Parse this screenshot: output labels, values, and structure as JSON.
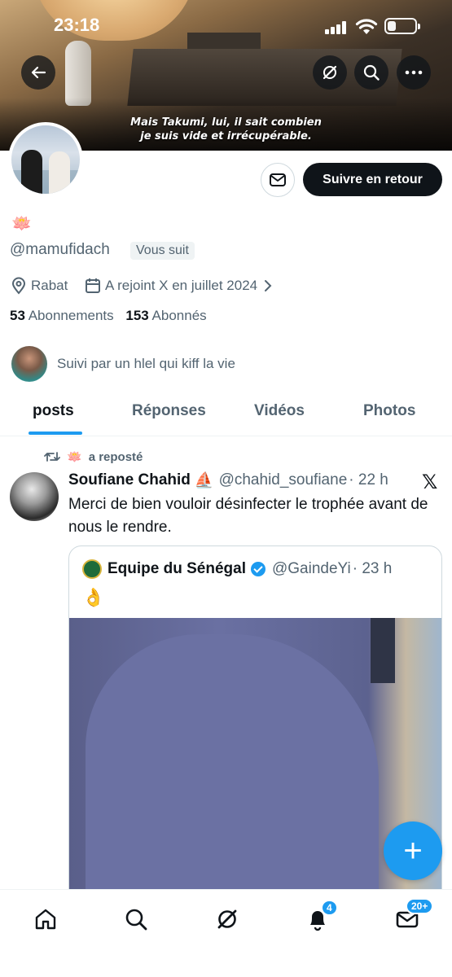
{
  "status_bar": {
    "time": "23:18"
  },
  "banner": {
    "subtitle_line1": "Mais Takumi, lui, il sait combien",
    "subtitle_line2": "je suis vide et irrécupérable."
  },
  "header_actions": {
    "back": "back-arrow-icon",
    "grok": "grok-icon",
    "search": "search-icon",
    "more": "more-icon"
  },
  "profile": {
    "display_name_emoji": "🪷",
    "handle": "@mamufidach",
    "follows_you": "Vous suit",
    "follow_back_label": "Suivre en retour",
    "location": "Rabat",
    "joined": "A rejoint X en juillet 2024",
    "following_count": "53",
    "following_label": "Abonnements",
    "followers_count": "153",
    "followers_label": "Abonnés",
    "followed_by": "Suivi par un hlel qui kiff la vie"
  },
  "tabs": [
    {
      "label": "posts",
      "active": true
    },
    {
      "label": "Réponses",
      "active": false
    },
    {
      "label": "Vidéos",
      "active": false
    },
    {
      "label": "Photos",
      "active": false
    }
  ],
  "tweet": {
    "repost_emoji": "🪷",
    "repost_text": "a reposté",
    "author_name": "Soufiane Chahid",
    "author_emoji": "⛵",
    "author_handle": "@chahid_soufiane",
    "time": "· 22 h",
    "text": "Merci de bien vouloir désinfecter le trophée avant de nous le rendre.",
    "quote": {
      "name": "Equipe du Sénégal",
      "handle": "@GaindeYi",
      "time": "· 23 h",
      "text": "👌"
    }
  },
  "fab_label": "+",
  "bottom_nav": {
    "notifications_badge": "4",
    "messages_badge": "20+"
  },
  "colors": {
    "accent": "#1d9bf0",
    "text": "#0f1419",
    "secondary": "#536471"
  }
}
